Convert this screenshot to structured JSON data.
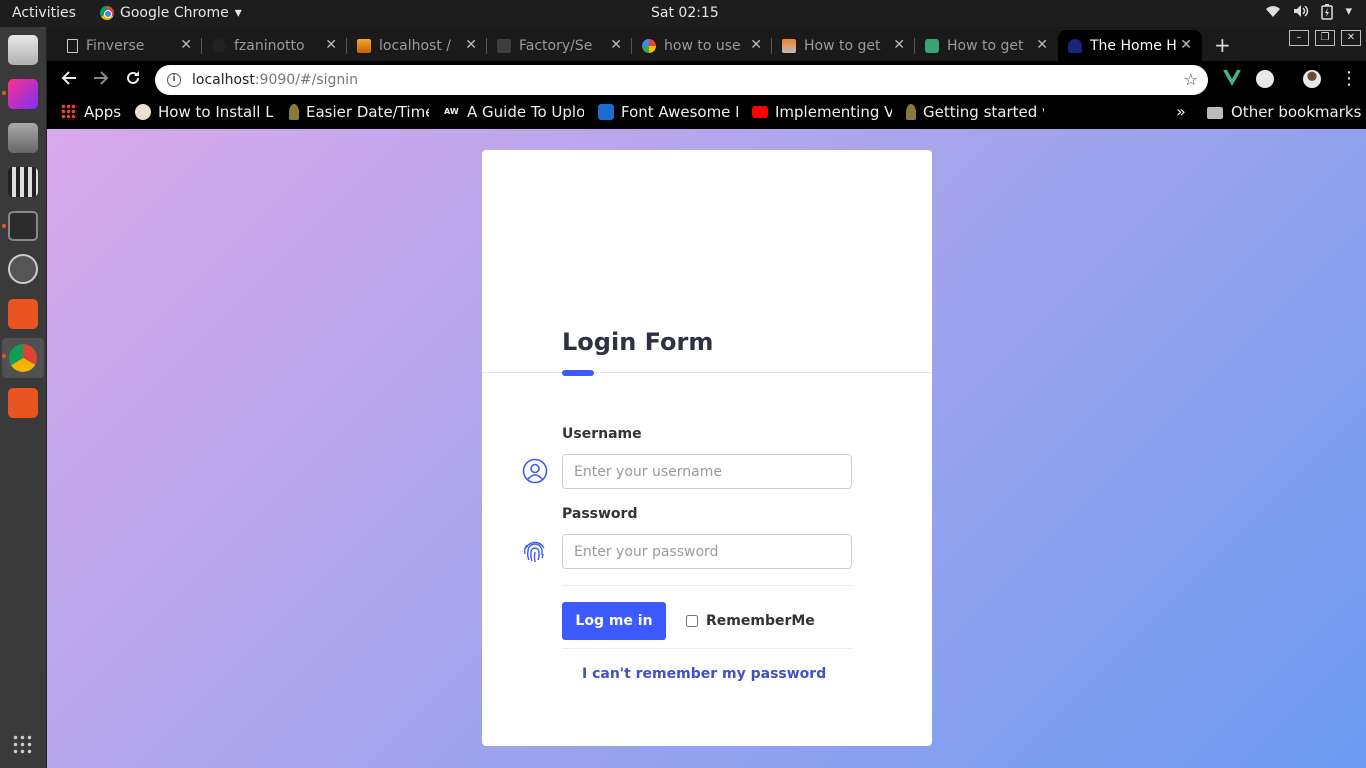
{
  "topbar": {
    "activities": "Activities",
    "app_name": "Google Chrome",
    "clock": "Sat 02:15"
  },
  "browser": {
    "tabs": [
      {
        "label": "Finverse",
        "icon": "document-icon"
      },
      {
        "label": "fzaninotto",
        "icon": "github-icon"
      },
      {
        "label": "localhost /",
        "icon": "phpmyadmin-icon"
      },
      {
        "label": "Factory/Se",
        "icon": "laravel-icon"
      },
      {
        "label": "how to use",
        "icon": "google-icon"
      },
      {
        "label": "How to get",
        "icon": "stackoverflow-icon"
      },
      {
        "label": "How to get",
        "icon": "laracasts-icon"
      },
      {
        "label": "The Home H",
        "icon": "site-icon",
        "active": true
      }
    ],
    "url": {
      "host": "localhost",
      "path": ":9090/#/signin"
    },
    "bookmarks": [
      {
        "label": "Apps",
        "icon": "apps-grid-icon"
      },
      {
        "label": "How to Install La",
        "icon": "bookmark-icon"
      },
      {
        "label": "Easier Date/Time",
        "icon": "bookmark-icon"
      },
      {
        "label": "A Guide To Uploa",
        "icon": "aw-icon"
      },
      {
        "label": "Font Awesome Ic",
        "icon": "flag-icon"
      },
      {
        "label": "Implementing Vu",
        "icon": "youtube-icon"
      },
      {
        "label": "Getting started v",
        "icon": "bookmark-icon"
      }
    ],
    "bookmarks_more": "»",
    "other_bookmarks": "Other bookmarks"
  },
  "login": {
    "title": "Login Form",
    "username_label": "Username",
    "username_placeholder": "Enter your username",
    "password_label": "Password",
    "password_placeholder": "Enter your password",
    "submit": "Log me in",
    "remember": "RememberMe",
    "forgot": "I can't remember my password"
  },
  "colors": {
    "accent": "#3d5afe",
    "link": "#4050c9",
    "gradient_start": "#d9a9ec",
    "gradient_end": "#6c9bf0"
  }
}
